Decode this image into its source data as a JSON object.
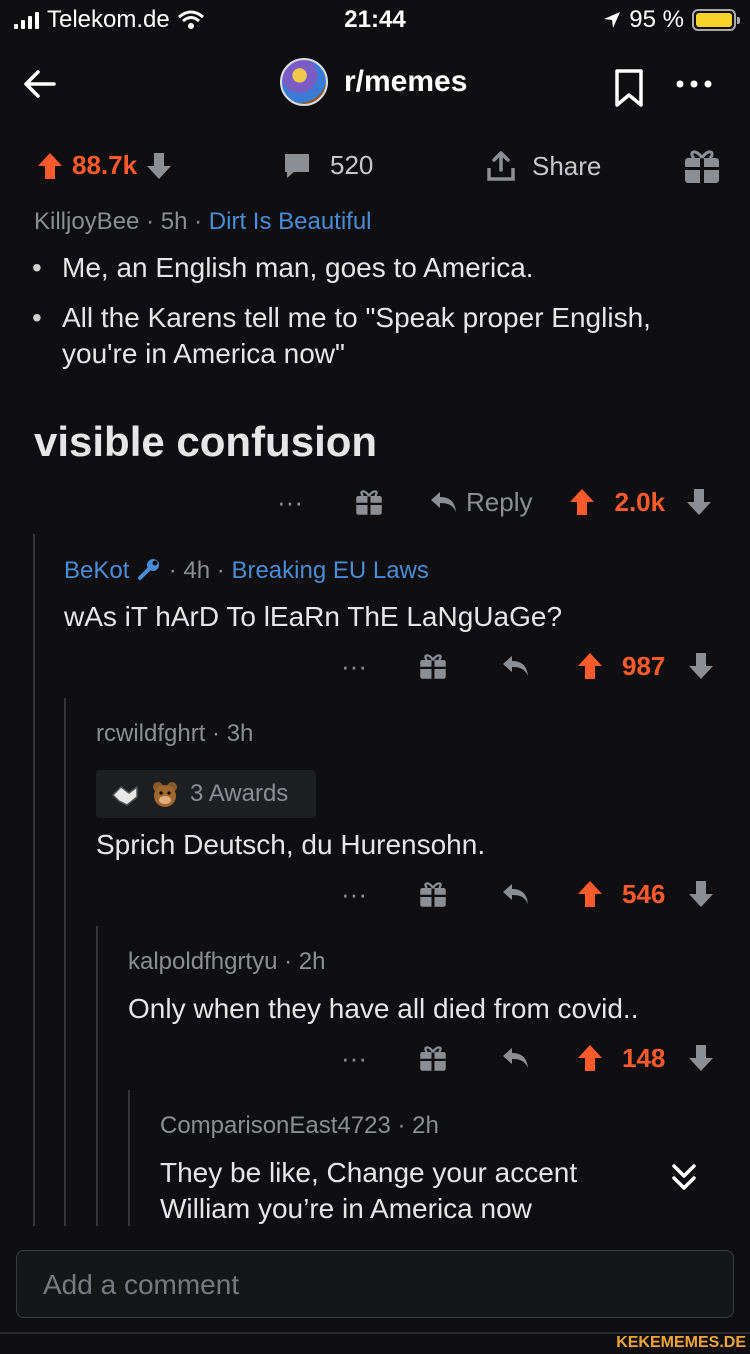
{
  "status_bar": {
    "carrier": "Telekom.de",
    "time": "21:44",
    "battery": "95 %"
  },
  "header": {
    "subreddit": "r/memes"
  },
  "post": {
    "upvotes": "88.7k",
    "comments": "520",
    "share_label": "Share",
    "author": "KilljoyBee",
    "age": "5h",
    "flair": "Dirt Is Beautiful",
    "separator": "·",
    "bullets": [
      "Me, an English man, goes to America.",
      "All the Karens tell me to \"Speak proper English, you're in America now\""
    ],
    "title_text": "visible confusion",
    "more_label": "···",
    "reply_label": "Reply",
    "score": "2.0k"
  },
  "comments": [
    {
      "author": "BeKot",
      "author_icon": "wrench-icon",
      "age": "4h",
      "flair": "Breaking EU Laws",
      "body": "wAs iT hArD To lEaRn ThE LaNgUaGe?",
      "score": "987"
    },
    {
      "author": "rcwildfghrt",
      "age": "3h",
      "awards_label": "3 Awards",
      "body": "Sprich Deutsch, du Hurensohn.",
      "score": "546"
    },
    {
      "author": "kalpoldfhgrtyu",
      "age": "2h",
      "body": "Only when they have all died from covid..",
      "score": "148"
    },
    {
      "author": "ComparisonEast4723",
      "age": "2h",
      "body_line1": "They be like, Change your accent",
      "body_line2": "William you’re in America now"
    }
  ],
  "composer": {
    "placeholder": "Add a comment"
  },
  "watermark": "KEKEMEMES.DE",
  "colors": {
    "upvote": "#ff5a2b",
    "link": "#4a8cd6",
    "background": "#0f0f11"
  }
}
